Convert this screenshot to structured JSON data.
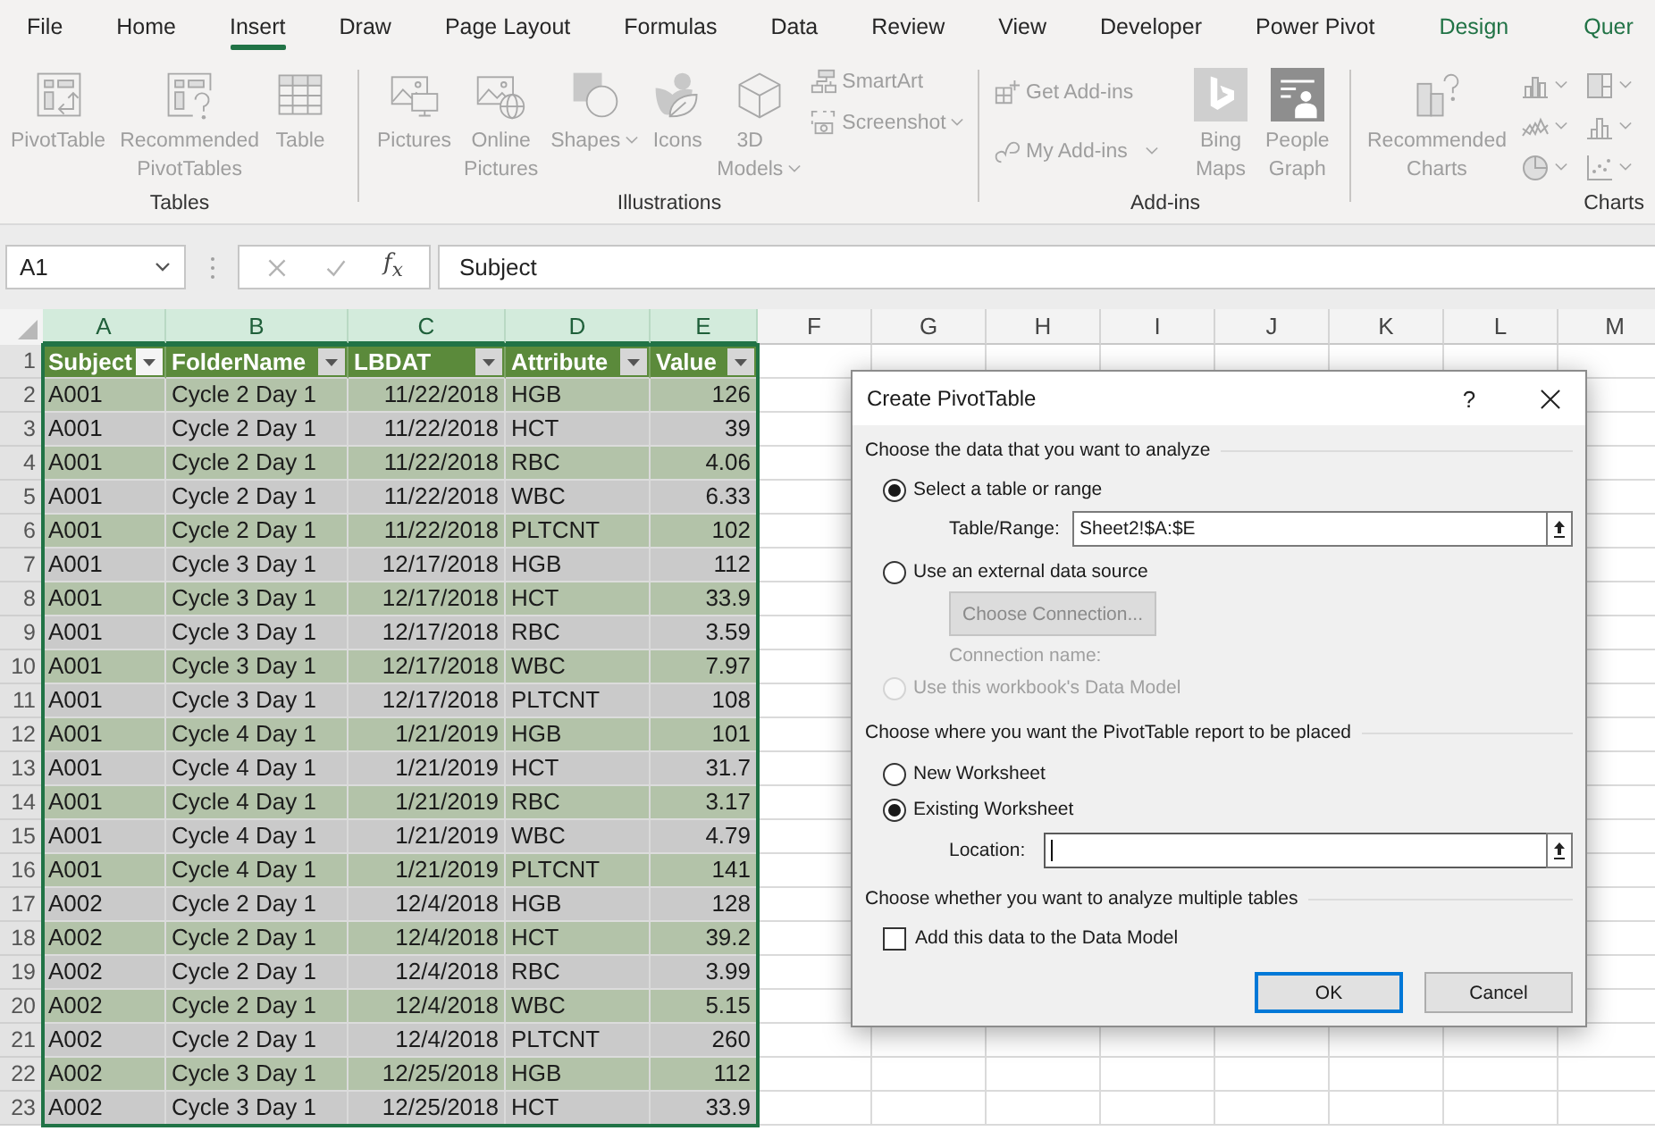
{
  "ribbon": {
    "tabs": [
      {
        "label": "File",
        "selected": false,
        "kind": "normal"
      },
      {
        "label": "Home",
        "selected": false,
        "kind": "normal"
      },
      {
        "label": "Insert",
        "selected": true,
        "kind": "normal"
      },
      {
        "label": "Draw",
        "selected": false,
        "kind": "normal"
      },
      {
        "label": "Page Layout",
        "selected": false,
        "kind": "normal"
      },
      {
        "label": "Formulas",
        "selected": false,
        "kind": "normal"
      },
      {
        "label": "Data",
        "selected": false,
        "kind": "normal"
      },
      {
        "label": "Review",
        "selected": false,
        "kind": "normal"
      },
      {
        "label": "View",
        "selected": false,
        "kind": "normal"
      },
      {
        "label": "Developer",
        "selected": false,
        "kind": "normal"
      },
      {
        "label": "Power Pivot",
        "selected": false,
        "kind": "normal"
      },
      {
        "label": "Design",
        "selected": false,
        "kind": "contextual"
      },
      {
        "label": "Quer",
        "selected": false,
        "kind": "contextual"
      }
    ],
    "disabled": true,
    "groups": [
      {
        "label": "Tables",
        "buttons": [
          {
            "label": "PivotTable",
            "menu": false
          },
          {
            "label": "Recommended PivotTables",
            "menu": false
          },
          {
            "label": "Table",
            "menu": false
          }
        ]
      },
      {
        "label": "Illustrations",
        "buttons": [
          {
            "label": "Pictures",
            "menu": false
          },
          {
            "label": "Online Pictures",
            "menu": false
          },
          {
            "label": "Shapes",
            "menu": true
          },
          {
            "label": "Icons",
            "menu": false
          },
          {
            "label": "3D Models",
            "menu": true
          }
        ],
        "small_buttons": [
          {
            "label": "SmartArt",
            "menu": false
          },
          {
            "label": "Screenshot",
            "menu": true
          }
        ]
      },
      {
        "label": "Add-ins",
        "small_buttons": [
          {
            "label": "Get Add-ins",
            "menu": false
          },
          {
            "label": "My Add-ins",
            "menu": true
          }
        ],
        "buttons": [
          {
            "label": "Bing Maps",
            "menu": false
          },
          {
            "label": "People Graph",
            "menu": false
          }
        ]
      },
      {
        "label": "Charts",
        "buttons": [
          {
            "label": "Recommended Charts",
            "menu": false
          }
        ]
      }
    ]
  },
  "formula_bar": {
    "name_box": "A1",
    "function_label": "f$_{x}$",
    "value": "Subject"
  },
  "sheet": {
    "columns": [
      {
        "label": "A",
        "selected": true
      },
      {
        "label": "B",
        "selected": true
      },
      {
        "label": "C",
        "selected": true
      },
      {
        "label": "D",
        "selected": true
      },
      {
        "label": "E",
        "selected": true
      },
      {
        "label": "F",
        "selected": false
      },
      {
        "label": "G",
        "selected": false
      },
      {
        "label": "H",
        "selected": false
      },
      {
        "label": "I",
        "selected": false
      },
      {
        "label": "J",
        "selected": false
      },
      {
        "label": "K",
        "selected": false
      },
      {
        "label": "L",
        "selected": false
      },
      {
        "label": "M",
        "selected": false
      }
    ],
    "rows": [
      "1",
      "2",
      "3",
      "4",
      "5",
      "6",
      "7",
      "8",
      "9",
      "10",
      "11",
      "12",
      "13",
      "14",
      "15",
      "16",
      "17",
      "18",
      "19",
      "20",
      "21",
      "22",
      "23"
    ],
    "table": {
      "headers": [
        "Subject",
        "FolderName",
        "LBDAT",
        "Attribute",
        "Value"
      ],
      "rows": [
        [
          "A001",
          "Cycle 2 Day 1",
          "11/22/2018",
          "HGB",
          "126"
        ],
        [
          "A001",
          "Cycle 2 Day 1",
          "11/22/2018",
          "HCT",
          "39"
        ],
        [
          "A001",
          "Cycle 2 Day 1",
          "11/22/2018",
          "RBC",
          "4.06"
        ],
        [
          "A001",
          "Cycle 2 Day 1",
          "11/22/2018",
          "WBC",
          "6.33"
        ],
        [
          "A001",
          "Cycle 2 Day 1",
          "11/22/2018",
          "PLTCNT",
          "102"
        ],
        [
          "A001",
          "Cycle 3 Day 1",
          "12/17/2018",
          "HGB",
          "112"
        ],
        [
          "A001",
          "Cycle 3 Day 1",
          "12/17/2018",
          "HCT",
          "33.9"
        ],
        [
          "A001",
          "Cycle 3 Day 1",
          "12/17/2018",
          "RBC",
          "3.59"
        ],
        [
          "A001",
          "Cycle 3 Day 1",
          "12/17/2018",
          "WBC",
          "7.97"
        ],
        [
          "A001",
          "Cycle 3 Day 1",
          "12/17/2018",
          "PLTCNT",
          "108"
        ],
        [
          "A001",
          "Cycle 4 Day 1",
          "1/21/2019",
          "HGB",
          "101"
        ],
        [
          "A001",
          "Cycle 4 Day 1",
          "1/21/2019",
          "HCT",
          "31.7"
        ],
        [
          "A001",
          "Cycle 4 Day 1",
          "1/21/2019",
          "RBC",
          "3.17"
        ],
        [
          "A001",
          "Cycle 4 Day 1",
          "1/21/2019",
          "WBC",
          "4.79"
        ],
        [
          "A001",
          "Cycle 4 Day 1",
          "1/21/2019",
          "PLTCNT",
          "141"
        ],
        [
          "A002",
          "Cycle 2 Day 1",
          "12/4/2018",
          "HGB",
          "128"
        ],
        [
          "A002",
          "Cycle 2 Day 1",
          "12/4/2018",
          "HCT",
          "39.2"
        ],
        [
          "A002",
          "Cycle 2 Day 1",
          "12/4/2018",
          "RBC",
          "3.99"
        ],
        [
          "A002",
          "Cycle 2 Day 1",
          "12/4/2018",
          "WBC",
          "5.15"
        ],
        [
          "A002",
          "Cycle 2 Day 1",
          "12/4/2018",
          "PLTCNT",
          "260"
        ],
        [
          "A002",
          "Cycle 3 Day 1",
          "12/25/2018",
          "HGB",
          "112"
        ],
        [
          "A002",
          "Cycle 3 Day 1",
          "12/25/2018",
          "HCT",
          "33.9"
        ]
      ]
    }
  },
  "dialog": {
    "title": "Create PivotTable",
    "help": "?",
    "source": {
      "heading": "Choose the data that you want to analyze",
      "options": [
        {
          "label": "Select a table or range",
          "selected": true,
          "disabled": false
        },
        {
          "label": "Use an external data source",
          "selected": false,
          "disabled": false
        },
        {
          "label": "Use this workbook's Data Model",
          "selected": false,
          "disabled": true
        }
      ],
      "range": {
        "label": "Table/Range:",
        "value": "Sheet2!$A:$E"
      },
      "connection_button": {
        "label": "Choose Connection...",
        "disabled": true
      },
      "connection_name": {
        "label": "Connection name:",
        "disabled": true
      }
    },
    "placement": {
      "heading": "Choose where you want the PivotTable report to be placed",
      "options": [
        {
          "label": "New Worksheet",
          "selected": false
        },
        {
          "label": "Existing Worksheet",
          "selected": true
        }
      ],
      "location": {
        "label": "Location:",
        "focused": true
      }
    },
    "multiple": {
      "heading": "Choose whether you want to analyze multiple tables",
      "checkbox": {
        "label": "Add this data to the Data Model",
        "checked": false
      }
    },
    "buttons": [
      {
        "label": "OK",
        "default": true
      },
      {
        "label": "Cancel",
        "default": false
      }
    ]
  }
}
